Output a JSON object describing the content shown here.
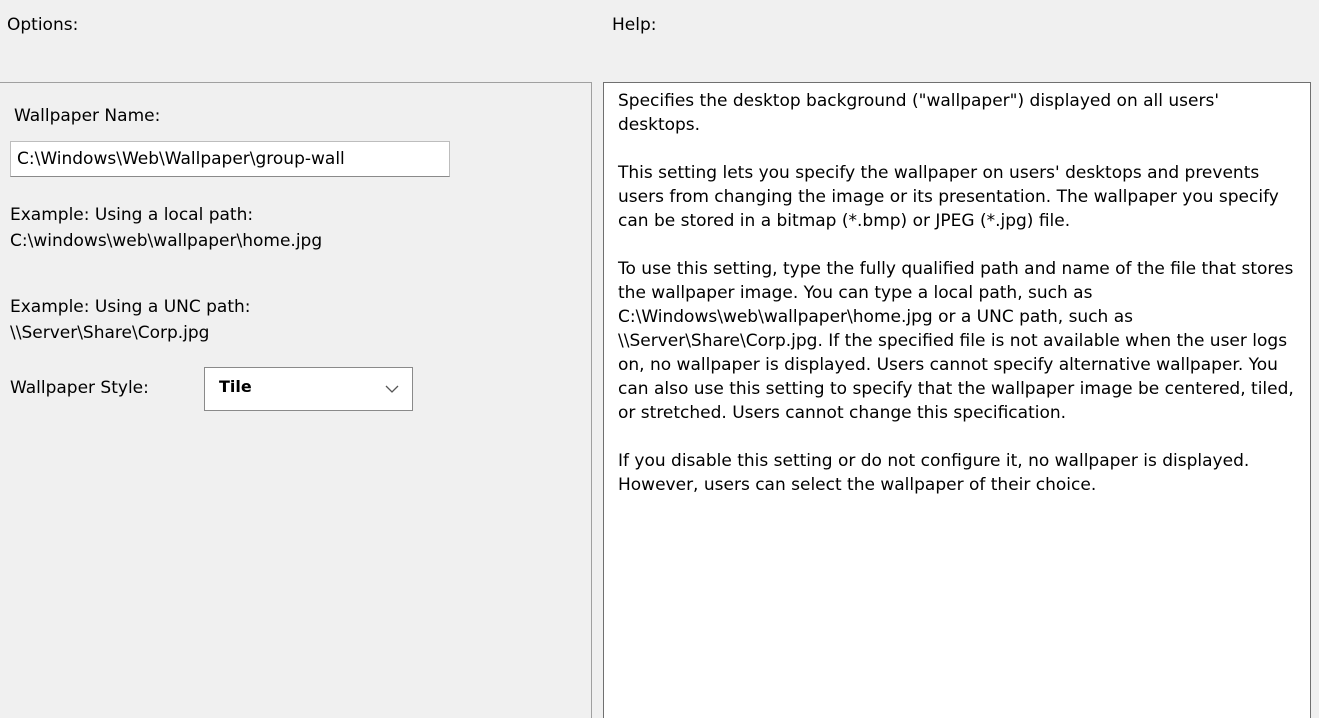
{
  "headers": {
    "options": "Options:",
    "help": "Help:"
  },
  "options": {
    "wallpaper_name_label": "Wallpaper Name:",
    "wallpaper_name_value": "C:\\Windows\\Web\\Wallpaper\\group-wall",
    "example_local_line1": "Example: Using a local path:",
    "example_local_line2": "C:\\windows\\web\\wallpaper\\home.jpg",
    "example_unc_line1": "Example: Using a UNC path:",
    "example_unc_line2": "\\\\Server\\Share\\Corp.jpg",
    "wallpaper_style_label": "Wallpaper Style:",
    "wallpaper_style_value": "Tile"
  },
  "help": {
    "text": "Specifies the desktop background (\"wallpaper\") displayed on all users' desktops.\n\nThis setting lets you specify the wallpaper on users' desktops and prevents users from changing the image or its presentation. The wallpaper you specify can be stored in a bitmap (*.bmp) or JPEG (*.jpg) file.\n\nTo use this setting, type the fully qualified path and name of the file that stores the wallpaper image. You can type a local path, such as C:\\Windows\\web\\wallpaper\\home.jpg or a UNC path, such as \\\\Server\\Share\\Corp.jpg. If the specified file is not available when the user logs on, no wallpaper is displayed. Users cannot specify alternative wallpaper. You can also use this setting to specify that the wallpaper image be centered, tiled, or stretched. Users cannot change this specification.\n\nIf you disable this setting or do not configure it, no wallpaper is displayed. However, users can select the wallpaper of their choice."
  },
  "icons": {
    "dropdown": "chevron-down-icon"
  }
}
